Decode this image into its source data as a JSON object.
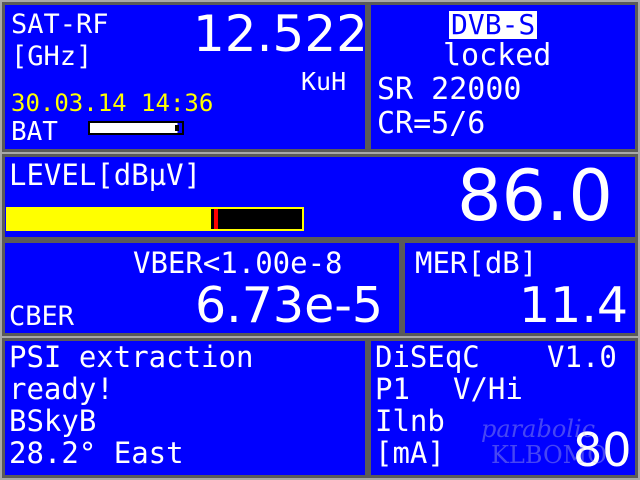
{
  "frequency_panel": {
    "title": "SAT-RF",
    "unit": "[GHz]",
    "value": "12.522",
    "band": "KuH",
    "datetime": "30.03.14 14:36",
    "battery_label": "BAT",
    "battery_level": 0.95
  },
  "signal_panel": {
    "standard": "DVB-S",
    "status": "locked",
    "symbol_rate": "SR 22000",
    "code_rate": "CR=5/6"
  },
  "level_panel": {
    "label": "LEVEL[dBµV]",
    "value": "86.0",
    "bar_fill": 0.69,
    "bar_marker": 0.7
  },
  "ber_panel": {
    "vber": "VBER<1.00e-8",
    "cber_label": "CBER",
    "cber_value": "6.73e-5"
  },
  "mer_panel": {
    "label": "MER[dB]",
    "value": "11.4"
  },
  "psi_panel": {
    "line1": "PSI extraction",
    "line2": "ready!",
    "line3": "BSkyB",
    "line4": "28.2° East"
  },
  "diseqc_panel": {
    "label": "DiSEqC",
    "version": "V1.0",
    "port": "P1",
    "polarization": "V/Hi",
    "current_label": "Ilnb",
    "current_unit": "[mA]",
    "current_value": "80"
  },
  "watermark": {
    "line1": "parabolic",
    "line2": "KLBOMO"
  },
  "colors": {
    "panel_bg": "#0000ff",
    "text": "#ffffff",
    "accent_yellow": "#ffff00",
    "marker_red": "#ff0000",
    "frame": "#5a5a5a"
  }
}
